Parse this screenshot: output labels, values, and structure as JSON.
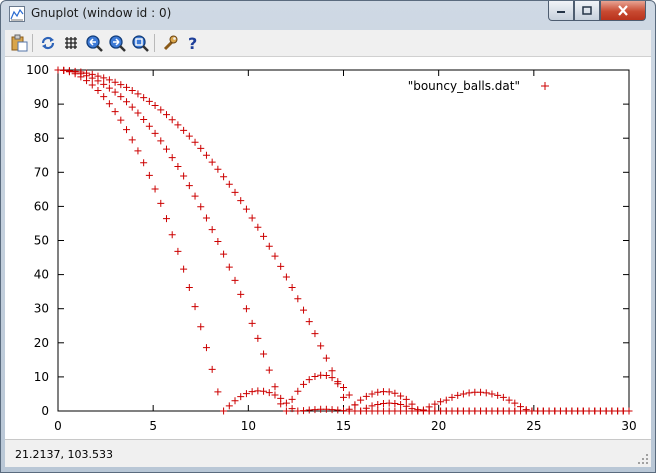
{
  "window": {
    "title": "Gnuplot (window id : 0)"
  },
  "toolbar": {
    "buttons": [
      {
        "name": "copy-to-clipboard",
        "icon": "clipboard-icon"
      },
      {
        "name": "replot",
        "icon": "refresh-icon"
      },
      {
        "name": "grid",
        "icon": "grid-icon"
      },
      {
        "name": "zoom-previous",
        "icon": "zoom-previous-icon"
      },
      {
        "name": "zoom-next",
        "icon": "zoom-next-icon"
      },
      {
        "name": "autoscale",
        "icon": "autoscale-icon"
      },
      {
        "name": "options",
        "icon": "wrench-icon"
      },
      {
        "name": "help",
        "icon": "help-icon"
      }
    ]
  },
  "status": {
    "coords": "21.2137,  103.533"
  },
  "colors": {
    "series": "#cc0000",
    "axis": "#000000"
  },
  "chart_data": {
    "type": "scatter",
    "title": "",
    "xlabel": "",
    "ylabel": "",
    "xlim": [
      0,
      30
    ],
    "ylim": [
      0,
      100
    ],
    "xticks": [
      "0",
      "5",
      "10",
      "15",
      "20",
      "25",
      "30"
    ],
    "yticks": [
      "0",
      "10",
      "20",
      "30",
      "40",
      "50",
      "60",
      "70",
      "80",
      "90",
      "100"
    ],
    "grid": false,
    "legend_position": "top-right",
    "series": [
      {
        "name": "\"bouncy_balls.dat\"",
        "marker": "+",
        "x": [
          0.0,
          0.3,
          0.6,
          0.9,
          1.2,
          1.5,
          1.8,
          2.1,
          2.4,
          2.7,
          3.0,
          3.3,
          3.6,
          3.9,
          4.2,
          4.5,
          4.8,
          5.1,
          5.4,
          5.7,
          6.0,
          6.3,
          6.6,
          6.9,
          7.2,
          7.5,
          7.8,
          8.1,
          8.4,
          8.7,
          9.0,
          9.3,
          9.6,
          9.9,
          10.2,
          10.5,
          10.8,
          11.1,
          11.4,
          11.7,
          12.0,
          12.3,
          12.6,
          12.9,
          13.2,
          13.5,
          13.8,
          14.1,
          14.4,
          14.7,
          15.0,
          15.3,
          15.6,
          15.9,
          16.2,
          16.5,
          16.8,
          17.1,
          17.4,
          17.7,
          18.0,
          18.3,
          18.6,
          18.9,
          19.2,
          19.5,
          19.8,
          20.1,
          20.4,
          20.7,
          21.0,
          21.3,
          21.6,
          21.9,
          22.2,
          22.5,
          22.8,
          23.1,
          23.4,
          23.7,
          24.0,
          24.3,
          24.6,
          24.9,
          25.2,
          25.5,
          25.8,
          26.1,
          26.4,
          26.7,
          27.0,
          27.3,
          27.6,
          27.9,
          28.2,
          28.5,
          28.8,
          29.1,
          29.4,
          29.7,
          30.0,
          0.0,
          0.3,
          0.6,
          0.9,
          1.2,
          1.5,
          1.8,
          2.1,
          2.4,
          2.7,
          3.0,
          3.3,
          3.6,
          3.9,
          4.2,
          4.5,
          4.8,
          5.1,
          5.4,
          5.7,
          6.0,
          6.3,
          6.6,
          6.9,
          7.2,
          7.5,
          7.8,
          8.1,
          8.4,
          8.7,
          9.0,
          9.3,
          9.6,
          9.9,
          10.2,
          10.5,
          10.8,
          11.1,
          11.4,
          11.7,
          12.0,
          12.3,
          12.6,
          12.9,
          13.2,
          13.5,
          13.8,
          14.1,
          14.4,
          14.7,
          15.0,
          15.3,
          15.6,
          15.9,
          16.2,
          16.5,
          16.8,
          17.1,
          17.4,
          17.7,
          18.0,
          18.3,
          18.6,
          18.9,
          19.2,
          19.5,
          19.8,
          20.1,
          20.4,
          20.7,
          21.0,
          21.3,
          21.6,
          21.9,
          22.2,
          22.5,
          22.8,
          23.1,
          23.4,
          23.7,
          24.0,
          24.3,
          24.6,
          24.9,
          25.2,
          25.5,
          25.8,
          26.1,
          26.4,
          26.7,
          27.0,
          27.3,
          27.6,
          27.9,
          28.2,
          28.5,
          28.8,
          29.1,
          29.4,
          29.7,
          30.0,
          0.0,
          0.3,
          0.6,
          0.9,
          1.2,
          1.5,
          1.8,
          2.1,
          2.4,
          2.7,
          3.0,
          3.3,
          3.6,
          3.9,
          4.2,
          4.5,
          4.8,
          5.1,
          5.4,
          5.7,
          6.0,
          6.3,
          6.6,
          6.9,
          7.2,
          7.5,
          7.8,
          8.1,
          8.4,
          8.7,
          9.0,
          9.3,
          9.6,
          9.9,
          10.2,
          10.5,
          10.8,
          11.1,
          11.4,
          11.7,
          12.0,
          12.3,
          12.6,
          12.9,
          13.2,
          13.5,
          13.8,
          14.1,
          14.4,
          14.7,
          15.0,
          15.3,
          15.6,
          15.9,
          16.2,
          16.5,
          16.8,
          17.1,
          17.4,
          17.7,
          18.0,
          18.3,
          18.6,
          18.9,
          19.2,
          19.5,
          19.8,
          20.1,
          20.4,
          20.7,
          21.0,
          21.3,
          21.6,
          21.9,
          22.2,
          22.5,
          22.8,
          23.1,
          23.4,
          23.7,
          24.0,
          24.3,
          24.6,
          24.9,
          25.2,
          25.5,
          25.8,
          26.1,
          26.4,
          26.7,
          27.0,
          27.3,
          27.6,
          27.9,
          28.2,
          28.5,
          28.8,
          29.1,
          29.4,
          29.7,
          30.0
        ],
        "y": [
          100.0,
          99.9,
          99.5,
          98.9,
          98.0,
          96.9,
          95.6,
          94.0,
          92.2,
          90.1,
          87.8,
          85.3,
          82.5,
          79.5,
          76.3,
          72.8,
          69.1,
          65.1,
          60.9,
          56.4,
          51.7,
          46.8,
          41.6,
          36.2,
          30.6,
          24.7,
          18.6,
          12.2,
          5.6,
          0.0,
          1.5,
          3.0,
          4.2,
          5.1,
          5.7,
          5.9,
          5.8,
          5.4,
          4.7,
          3.7,
          2.3,
          0.7,
          0.0,
          0.1,
          0.3,
          0.4,
          0.5,
          0.5,
          0.4,
          0.3,
          0.1,
          0.0,
          0.0,
          0.0,
          0.0,
          0.0,
          0.0,
          0.0,
          0.0,
          0.0,
          0.0,
          0.0,
          0.0,
          0.0,
          0.0,
          0.0,
          0.0,
          0.0,
          0.0,
          0.0,
          0.0,
          0.0,
          0.0,
          0.0,
          0.0,
          0.0,
          0.0,
          0.0,
          0.0,
          0.0,
          0.0,
          0.0,
          0.0,
          0.0,
          0.0,
          0.0,
          0.0,
          0.0,
          0.0,
          0.0,
          0.0,
          0.0,
          0.0,
          0.0,
          0.0,
          0.0,
          0.0,
          0.0,
          0.0,
          0.0,
          0.0,
          100.0,
          99.9,
          99.7,
          99.4,
          98.9,
          98.3,
          97.6,
          96.8,
          95.8,
          94.7,
          93.5,
          92.2,
          90.7,
          89.1,
          87.4,
          85.5,
          83.5,
          81.4,
          79.2,
          76.8,
          74.3,
          71.7,
          68.9,
          66.1,
          63.0,
          59.9,
          56.6,
          53.2,
          49.7,
          46.0,
          42.2,
          38.3,
          34.2,
          30.0,
          25.7,
          21.3,
          16.7,
          12.0,
          7.1,
          2.1,
          0.0,
          3.4,
          5.8,
          7.8,
          9.2,
          10.1,
          10.5,
          10.4,
          9.8,
          8.6,
          6.9,
          4.7,
          1.8,
          0.0,
          0.8,
          1.5,
          1.9,
          2.2,
          2.3,
          2.2,
          1.9,
          1.4,
          0.7,
          0.0,
          0.0,
          0.0,
          0.0,
          0.0,
          0.0,
          0.0,
          0.0,
          0.0,
          0.0,
          0.0,
          0.0,
          0.0,
          0.0,
          0.0,
          0.0,
          0.0,
          0.0,
          0.0,
          0.0,
          0.0,
          0.0,
          0.0,
          0.0,
          0.0,
          0.0,
          0.0,
          0.0,
          0.0,
          0.0,
          0.0,
          0.0,
          0.0,
          0.0,
          0.0,
          0.0,
          0.0,
          0.0,
          100.0,
          99.9,
          99.8,
          99.6,
          99.4,
          99.1,
          98.7,
          98.2,
          97.7,
          97.1,
          96.4,
          95.7,
          94.9,
          94.0,
          93.0,
          91.9,
          90.8,
          89.6,
          88.3,
          86.9,
          85.4,
          83.9,
          82.3,
          80.6,
          78.8,
          77.0,
          75.0,
          73.0,
          70.9,
          68.7,
          66.5,
          64.1,
          61.7,
          59.2,
          56.6,
          53.9,
          51.2,
          48.3,
          45.4,
          42.4,
          39.3,
          36.2,
          32.9,
          29.6,
          26.2,
          22.7,
          19.1,
          15.5,
          11.8,
          8.0,
          4.0,
          0.5,
          1.8,
          3.2,
          4.3,
          5.0,
          5.5,
          5.7,
          5.6,
          5.2,
          4.4,
          3.4,
          2.0,
          0.4,
          0.3,
          1.2,
          2.0,
          2.7,
          3.2,
          4.0,
          4.6,
          5.0,
          5.3,
          5.5,
          5.5,
          5.3,
          5.0,
          4.6,
          4.0,
          3.2,
          2.3,
          1.3,
          0.4,
          0.0,
          0.0,
          0.0,
          0.0,
          0.0,
          0.0,
          0.0,
          0.0,
          0.0,
          0.0,
          0.0,
          0.0,
          0.0,
          0.0,
          0.0,
          0.0,
          0.0,
          0.0
        ]
      }
    ]
  }
}
